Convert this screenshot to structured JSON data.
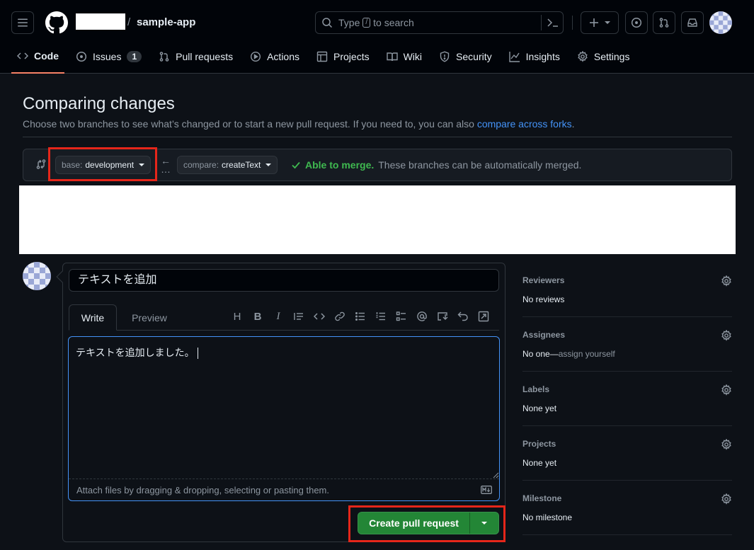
{
  "header": {
    "repo_name": "sample-app",
    "separator": "/",
    "search_placeholder_prefix": "Type",
    "search_key": "/",
    "search_placeholder_suffix": "to search"
  },
  "tabs": [
    {
      "label": "Code",
      "icon": "code-icon",
      "active": true
    },
    {
      "label": "Issues",
      "icon": "issue-icon",
      "count": "1"
    },
    {
      "label": "Pull requests",
      "icon": "pull-request-icon"
    },
    {
      "label": "Actions",
      "icon": "play-icon"
    },
    {
      "label": "Projects",
      "icon": "table-icon"
    },
    {
      "label": "Wiki",
      "icon": "book-icon"
    },
    {
      "label": "Security",
      "icon": "shield-icon"
    },
    {
      "label": "Insights",
      "icon": "graph-icon"
    },
    {
      "label": "Settings",
      "icon": "gear-icon"
    }
  ],
  "compare": {
    "title": "Comparing changes",
    "subtitle_text": "Choose two branches to see what’s changed or to start a new pull request. If you need to, you can also",
    "subtitle_link": "compare across forks",
    "subtitle_end": ".",
    "base_prefix": "base:",
    "base_branch": "development",
    "compare_prefix": "compare:",
    "compare_branch": "createText",
    "merge_ok": "Able to merge.",
    "merge_msg": "These branches can be automatically merged."
  },
  "form": {
    "title_value": "テキストを追加",
    "tab_write": "Write",
    "tab_preview": "Preview",
    "toolbar_heading": "H",
    "toolbar_bold": "B",
    "toolbar_italic": "I",
    "body_value": "テキストを追加しました。",
    "attach_hint": "Attach files by dragging & dropping, selecting or pasting them.",
    "submit_label": "Create pull request"
  },
  "sidebar": {
    "reviewers": {
      "heading": "Reviewers",
      "value": "No reviews"
    },
    "assignees": {
      "heading": "Assignees",
      "value": "No one—",
      "link": "assign yourself"
    },
    "labels": {
      "heading": "Labels",
      "value": "None yet"
    },
    "projects": {
      "heading": "Projects",
      "value": "None yet"
    },
    "milestone": {
      "heading": "Milestone",
      "value": "No milestone"
    }
  },
  "colors": {
    "accent_link": "#4493f8",
    "merge_green": "#3fb950",
    "button_green": "#238636",
    "highlight_red": "#e5261a",
    "active_tab_underline": "#f78166"
  }
}
